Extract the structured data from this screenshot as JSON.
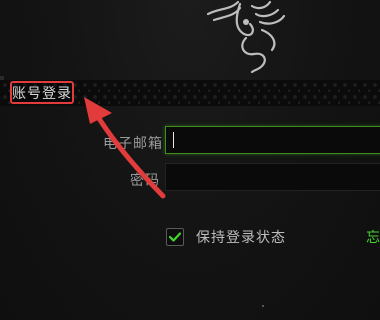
{
  "login_tab": {
    "label": "账号登录"
  },
  "form": {
    "email_label": "电子邮箱",
    "email_value": "",
    "password_label": "密码",
    "password_value": ""
  },
  "remember": {
    "label": "保持登录状态",
    "checked": true
  },
  "forgot": {
    "label": "忘"
  },
  "colors": {
    "accent_green": "#44d62c",
    "annotation_red": "#e23b3b",
    "background": "#121212"
  },
  "icons": {
    "logo": "razer-snake-logo-icon",
    "check": "check-icon",
    "annotation": "red-arrow-icon"
  }
}
